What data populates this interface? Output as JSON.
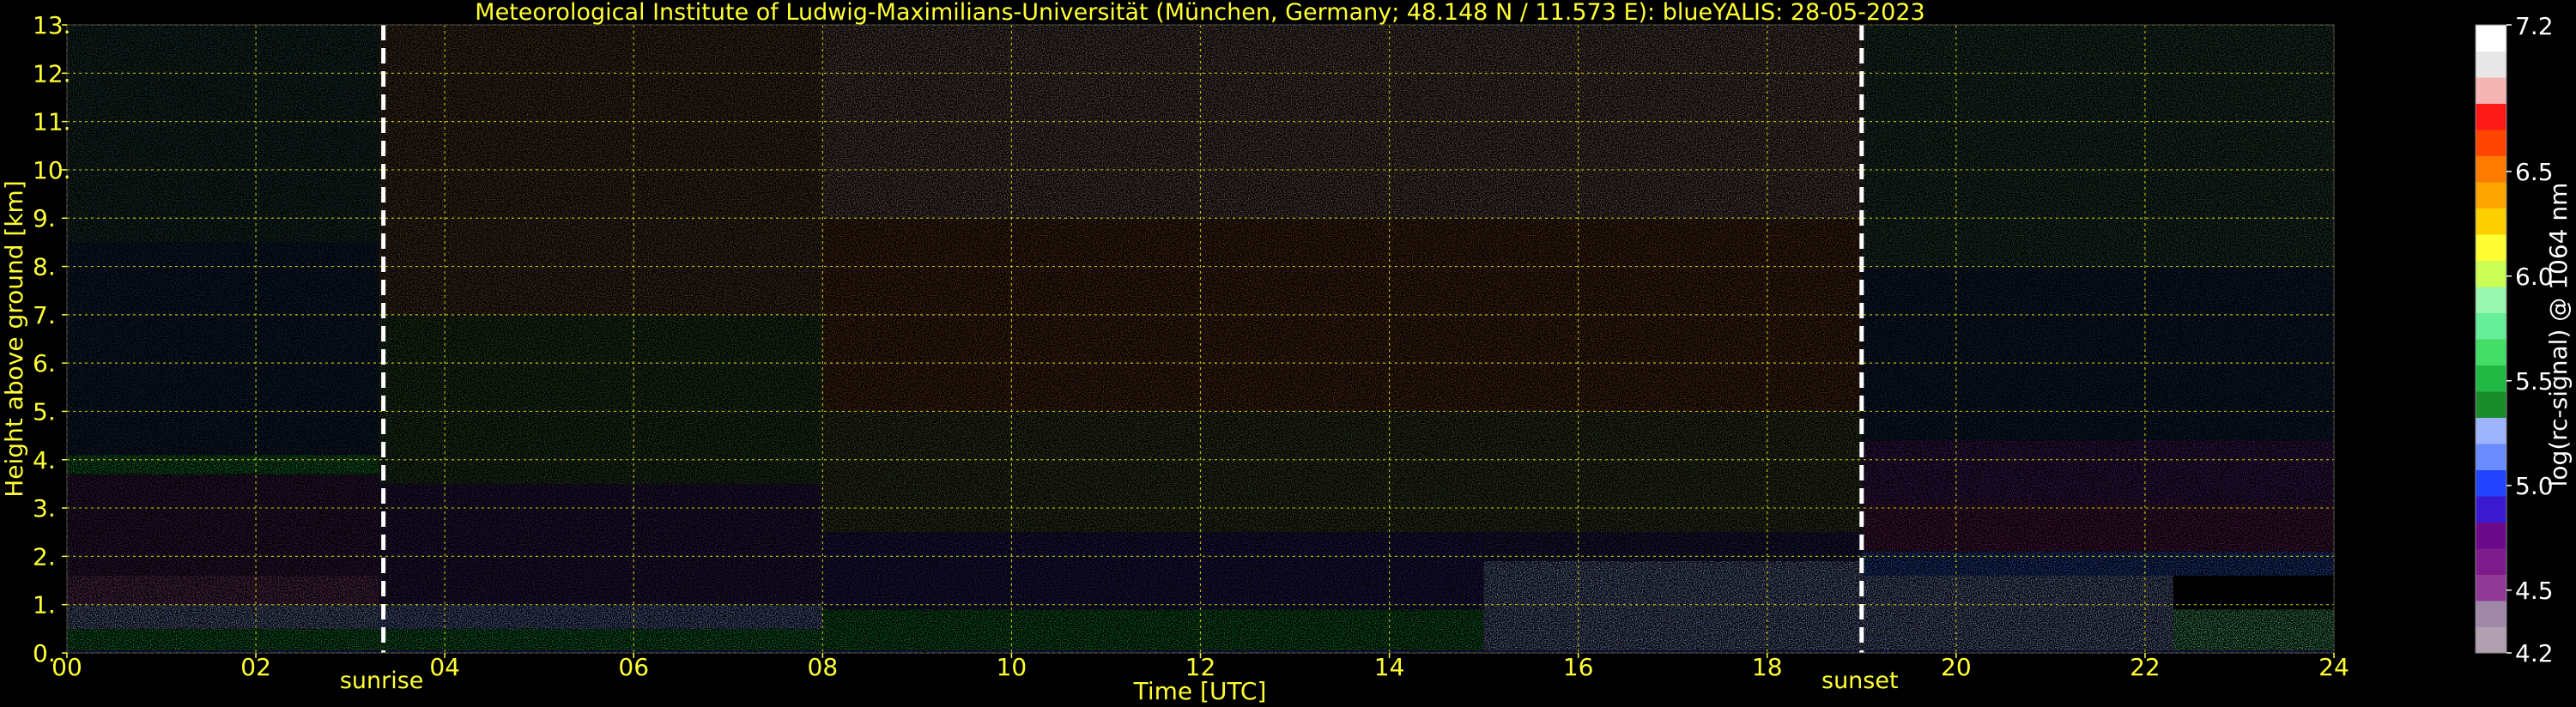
{
  "chart_data": {
    "type": "heatmap",
    "title": "Meteorological Institute of Ludwig-Maximilians-Universität (München, Germany; 48.148 N / 11.573 E):     blueYALIS: 28-05-2023",
    "xlabel": "Time [UTC]",
    "ylabel": "Height above ground [km]",
    "xlim": [
      0,
      24
    ],
    "ylim": [
      0,
      13
    ],
    "x_ticks": [
      "00",
      "02",
      "04",
      "06",
      "08",
      "10",
      "12",
      "14",
      "16",
      "18",
      "20",
      "22",
      "24"
    ],
    "x_tick_values": [
      0,
      2,
      4,
      6,
      8,
      10,
      12,
      14,
      16,
      18,
      20,
      22,
      24
    ],
    "y_ticks": [
      "0.",
      "1.",
      "2.",
      "3.",
      "4.",
      "5.",
      "6.",
      "7.",
      "8.",
      "9.",
      "10.",
      "11.",
      "12.",
      "13."
    ],
    "y_tick_values": [
      0,
      1,
      2,
      3,
      4,
      5,
      6,
      7,
      8,
      9,
      10,
      11,
      12,
      13
    ],
    "grid": true,
    "annotations": [
      {
        "label": "sunrise",
        "time": 3.35
      },
      {
        "label": "sunset",
        "time": 19.0
      }
    ],
    "colorbar": {
      "label": "log(rc-signal) @ 1064 nm",
      "range": [
        4.2,
        7.2
      ],
      "tick_labels": [
        "4.2",
        "4.5",
        "5.0",
        "5.5",
        "6.0",
        "6.5",
        "7.2"
      ],
      "tick_values": [
        4.2,
        4.5,
        5.0,
        5.5,
        6.0,
        6.5,
        7.2
      ],
      "colors": [
        "#b0a0b0",
        "#a089a8",
        "#903a95",
        "#7d1a8c",
        "#6a0a8a",
        "#3a1ad0",
        "#2244ff",
        "#6a8cff",
        "#9fb4ff",
        "#1a8c2a",
        "#22b844",
        "#44dd66",
        "#66ee99",
        "#99f7b0",
        "#ccff55",
        "#ffff33",
        "#ffd000",
        "#ffa500",
        "#ff7a00",
        "#ff4500",
        "#ff1a1a",
        "#f5b5b5",
        "#e8e8e8",
        "#ffffff"
      ]
    },
    "layers": [
      {
        "t0": 0,
        "t1": 24,
        "h0": 0.0,
        "h1": 0.05,
        "color": "#3d3dff"
      },
      {
        "t0": 0,
        "t1": 8,
        "h0": 0.05,
        "h1": 0.5,
        "color": "#22b844"
      },
      {
        "t0": 8,
        "t1": 15,
        "h0": 0.05,
        "h1": 0.9,
        "color": "#1fae3c"
      },
      {
        "t0": 0,
        "t1": 3.3,
        "h0": 0.5,
        "h1": 1.0,
        "color": "#9fb4ff"
      },
      {
        "t0": 3.3,
        "t1": 8,
        "h0": 0.5,
        "h1": 1.0,
        "color": "#8ea6ff"
      },
      {
        "t0": 15,
        "t1": 19,
        "h0": 0.05,
        "h1": 1.9,
        "color": "#9fb4ff"
      },
      {
        "t0": 19,
        "t1": 22.3,
        "h0": 0.05,
        "h1": 1.7,
        "color": "#9fb4ff"
      },
      {
        "t0": 22.3,
        "t1": 24,
        "h0": 0.05,
        "h1": 0.9,
        "color": "#66ee99"
      },
      {
        "t0": 19,
        "t1": 24,
        "h0": 1.6,
        "h1": 2.1,
        "color": "#3a6cff"
      },
      {
        "t0": 0,
        "t1": 3.3,
        "h0": 1.0,
        "h1": 1.6,
        "color": "#a0508f"
      },
      {
        "t0": 0,
        "t1": 3.3,
        "h0": 1.6,
        "h1": 3.7,
        "color": "#5a2c70"
      },
      {
        "t0": 0,
        "t1": 3.3,
        "h0": 3.7,
        "h1": 4.1,
        "color": "#22b844"
      },
      {
        "t0": 3.3,
        "t1": 8,
        "h0": 1.0,
        "h1": 3.5,
        "color": "#4a2a80"
      },
      {
        "t0": 8,
        "t1": 15,
        "h0": 0.9,
        "h1": 2.5,
        "color": "#3a2a90"
      },
      {
        "t0": 15,
        "t1": 19,
        "h0": 1.9,
        "h1": 3.0,
        "color": "#34307c"
      },
      {
        "t0": 19,
        "t1": 24,
        "h0": 2.1,
        "h1": 3.1,
        "color": "#8a2a78"
      },
      {
        "t0": 19,
        "t1": 24,
        "h0": 3.1,
        "h1": 4.4,
        "color": "#6a2a9a"
      },
      {
        "t0": 0,
        "t1": 3.3,
        "h0": 4.1,
        "h1": 8.5,
        "color": "#1f3a6a"
      },
      {
        "t0": 0,
        "t1": 3.3,
        "h0": 8.5,
        "h1": 13,
        "color": "#2a5a52"
      },
      {
        "t0": 19,
        "t1": 24,
        "h0": 4.4,
        "h1": 8.0,
        "color": "#1f3a6a"
      },
      {
        "t0": 19,
        "t1": 24,
        "h0": 8.0,
        "h1": 13,
        "color": "#3a6a50"
      },
      {
        "t0": 3.3,
        "t1": 8,
        "h0": 3.5,
        "h1": 7.0,
        "color": "#3e6a3a"
      },
      {
        "t0": 3.3,
        "t1": 8,
        "h0": 7.0,
        "h1": 13,
        "color": "#7a5a38"
      },
      {
        "t0": 8,
        "t1": 19,
        "h0": 2.5,
        "h1": 5.0,
        "color": "#5a6a3a"
      },
      {
        "t0": 8,
        "t1": 19,
        "h0": 5.0,
        "h1": 9.0,
        "color": "#8a4a2a"
      },
      {
        "t0": 8,
        "t1": 19,
        "h0": 9.0,
        "h1": 13,
        "color": "#9a7a70"
      }
    ]
  }
}
